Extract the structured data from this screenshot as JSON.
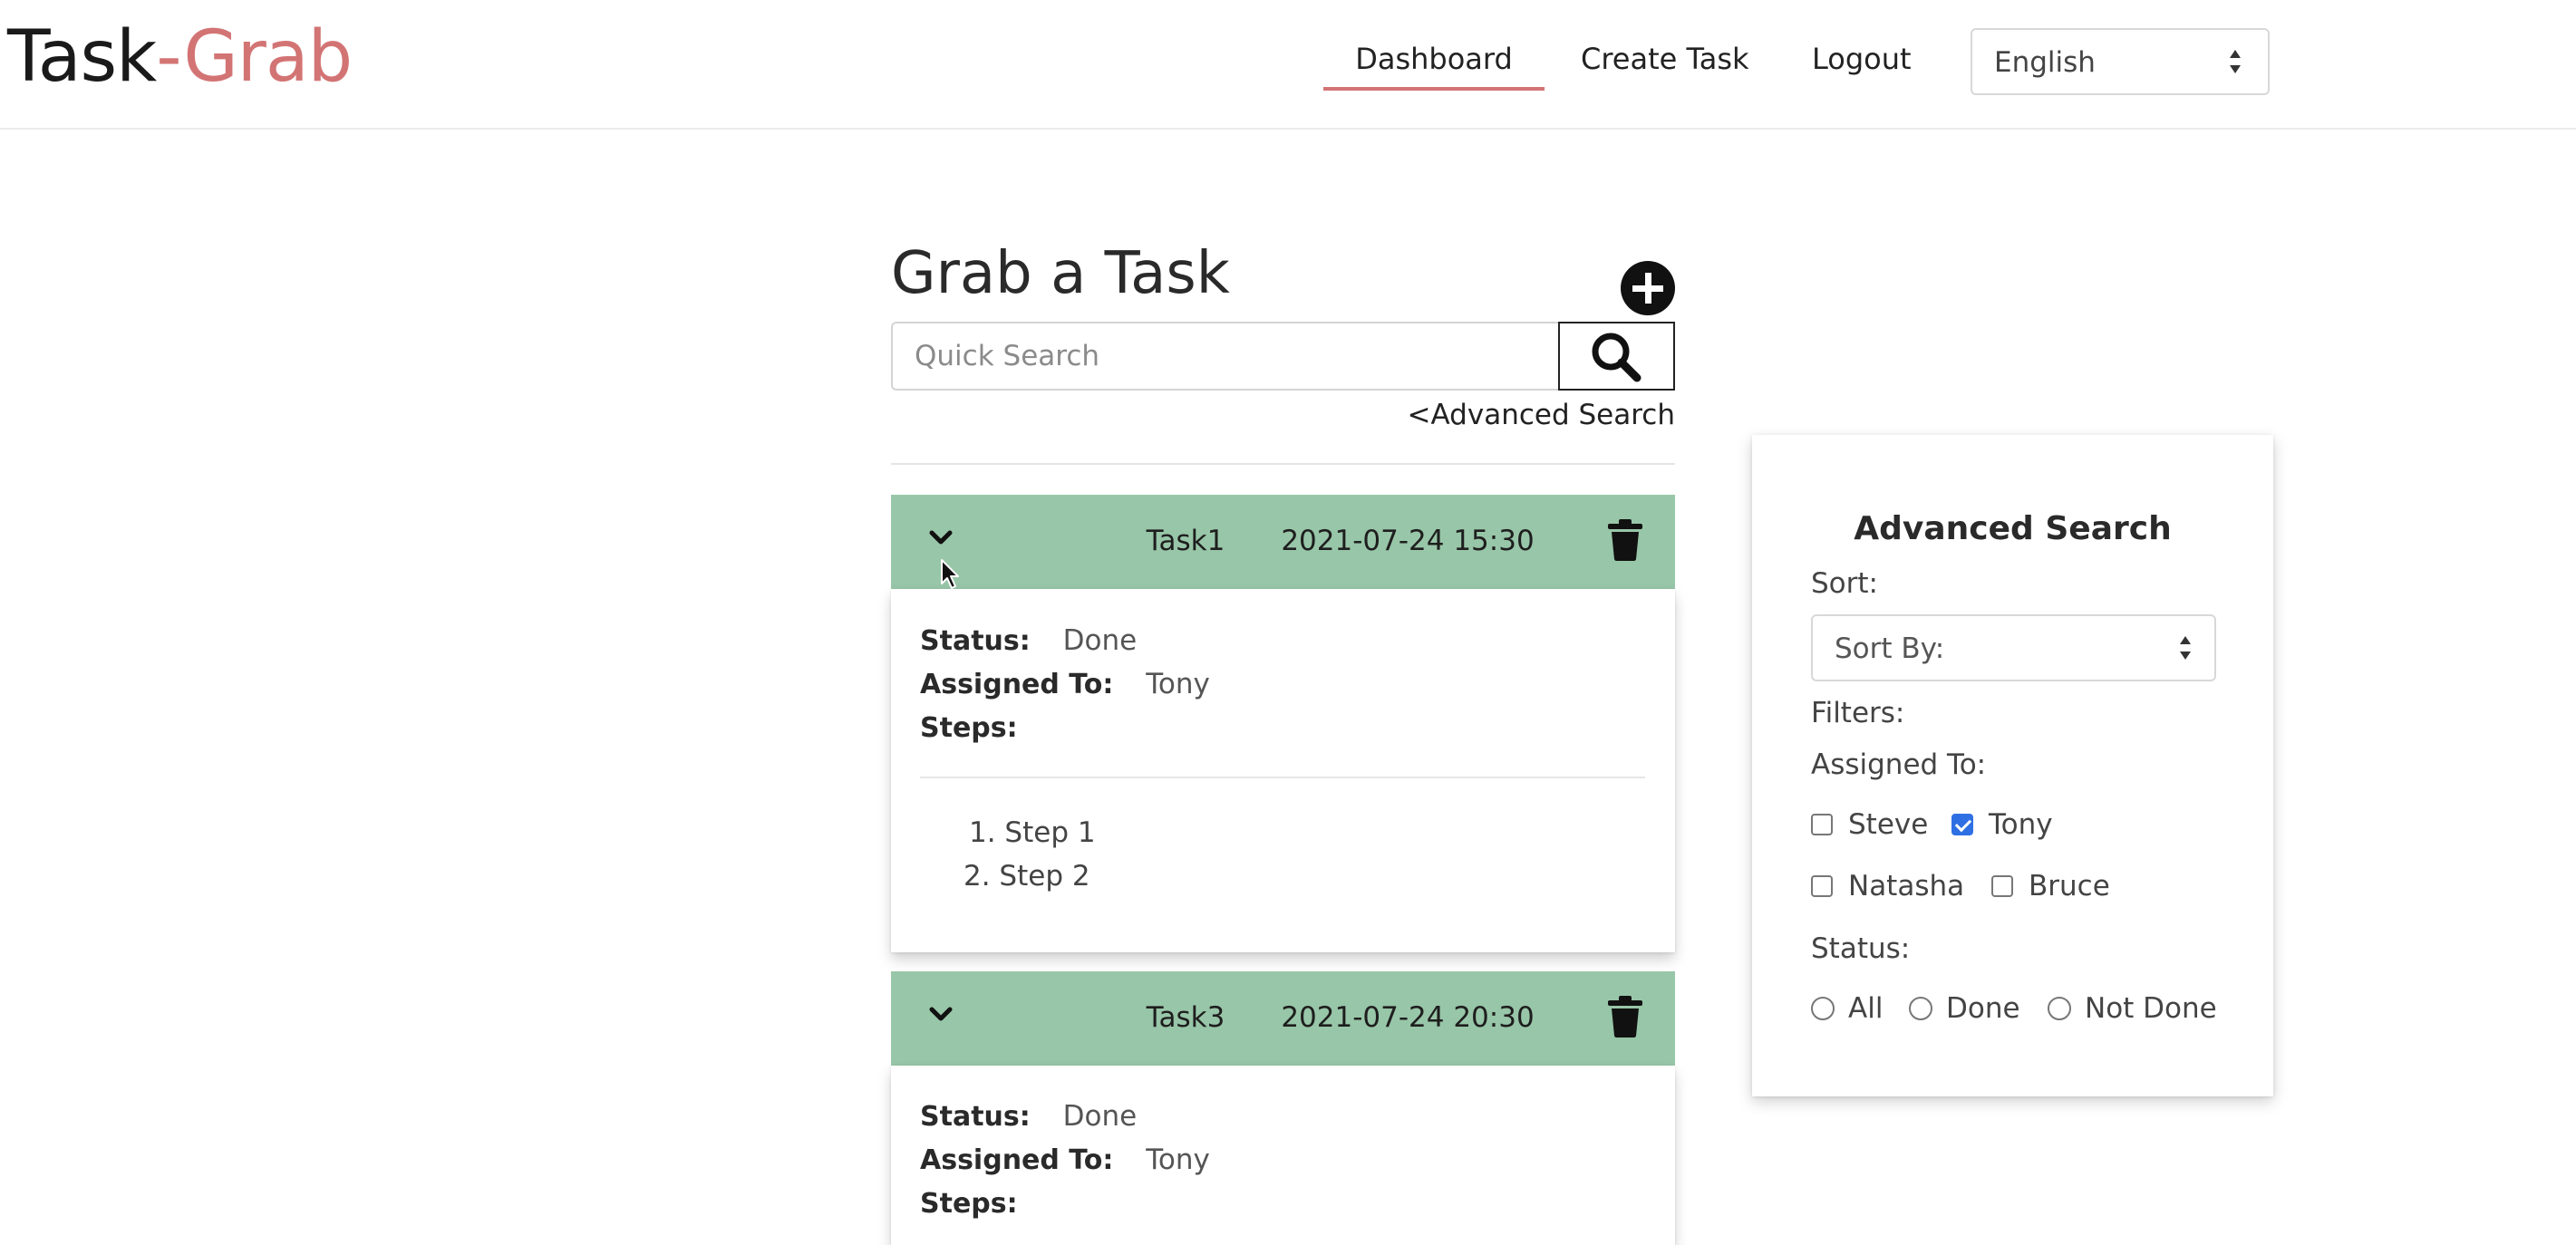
{
  "header": {
    "brand_main": "Task",
    "brand_accent": "-Grab",
    "nav": {
      "dashboard": "Dashboard",
      "create_task": "Create Task",
      "logout": "Logout"
    },
    "language_selected": "English"
  },
  "main": {
    "title": "Grab a Task",
    "add_icon": "plus-circle-icon",
    "search_placeholder": "Quick Search",
    "search_icon": "search-icon",
    "advanced_link": "<Advanced Search"
  },
  "tasks": [
    {
      "name": "Task1",
      "datetime": "2021-07-24 15:30",
      "status_label": "Status:",
      "status": "Done",
      "assigned_label": "Assigned To:",
      "assigned": "Tony",
      "steps_label": "Steps:",
      "steps": [
        "1. Step 1",
        "2. Step 2"
      ]
    },
    {
      "name": "Task3",
      "datetime": "2021-07-24 20:30",
      "status_label": "Status:",
      "status": "Done",
      "assigned_label": "Assigned To:",
      "assigned": "Tony",
      "steps_label": "Steps:"
    }
  ],
  "advanced": {
    "title": "Advanced Search",
    "sort_label": "Sort:",
    "sort_value": "Sort By:",
    "filters_label": "Filters:",
    "assigned_label": "Assigned To:",
    "assignees": [
      {
        "name": "Steve",
        "checked": false
      },
      {
        "name": "Tony",
        "checked": true
      },
      {
        "name": "Natasha",
        "checked": false
      },
      {
        "name": "Bruce",
        "checked": false
      }
    ],
    "status_label": "Status:",
    "status_options": [
      "All",
      "Done",
      "Not Done"
    ]
  },
  "colors": {
    "accent": "#d37474",
    "task_header": "#98c6a8",
    "checkbox_checked": "#2f6fe4"
  }
}
